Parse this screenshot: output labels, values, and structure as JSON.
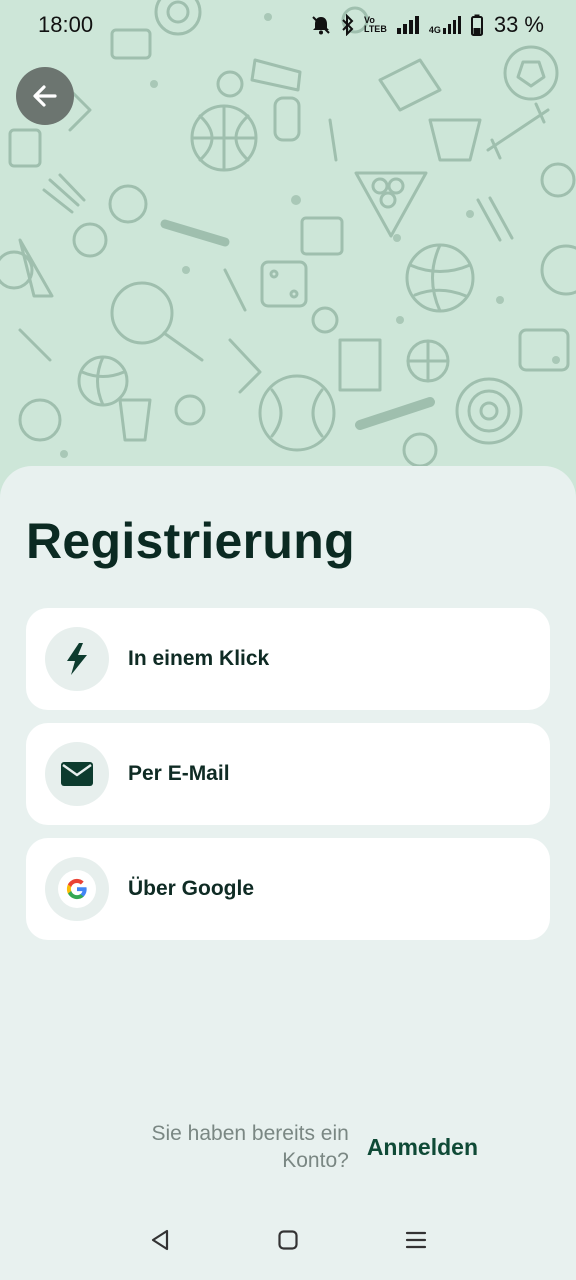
{
  "status_bar": {
    "time": "18:00",
    "battery": "33 %",
    "volte_top": "Vo",
    "volte_bottom": "LTEB",
    "net_type": "4G"
  },
  "header": {
    "back_icon": "arrow-left-icon"
  },
  "sheet": {
    "title": "Registrierung",
    "options": [
      {
        "label": "In einem Klick",
        "icon": "lightning-icon"
      },
      {
        "label": "Per E-Mail",
        "icon": "mail-icon"
      },
      {
        "label": "Über Google",
        "icon": "google-icon"
      }
    ],
    "login_hint": "Sie haben bereits ein Konto?",
    "login_link": "Anmelden"
  },
  "nav_bar": {
    "back": "triangle-back-icon",
    "home": "square-home-icon",
    "menu": "menu-lines-icon"
  },
  "colors": {
    "hero_bg": "#cde6d8",
    "sheet_bg": "#e8f1ef",
    "accent_dark": "#0f4a36",
    "google_blue": "#4285F4",
    "google_red": "#EA4335",
    "google_yellow": "#FBBC05",
    "google_green": "#34A853"
  }
}
